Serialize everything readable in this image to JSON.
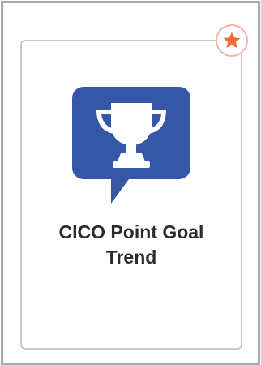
{
  "tile": {
    "title": "CICO Point Goal Trend",
    "icon": "trophy-speech-bubble-icon",
    "favorite_icon": "star-icon"
  },
  "colors": {
    "icon_background": "#3657a6",
    "icon_foreground": "#ffffff",
    "favorite_star": "#f26b3a",
    "favorite_ring": "#f4b3aa",
    "frame_border": "#a9a9a9",
    "tile_border": "#c9c9c9",
    "label_text": "#2b2b2b"
  }
}
